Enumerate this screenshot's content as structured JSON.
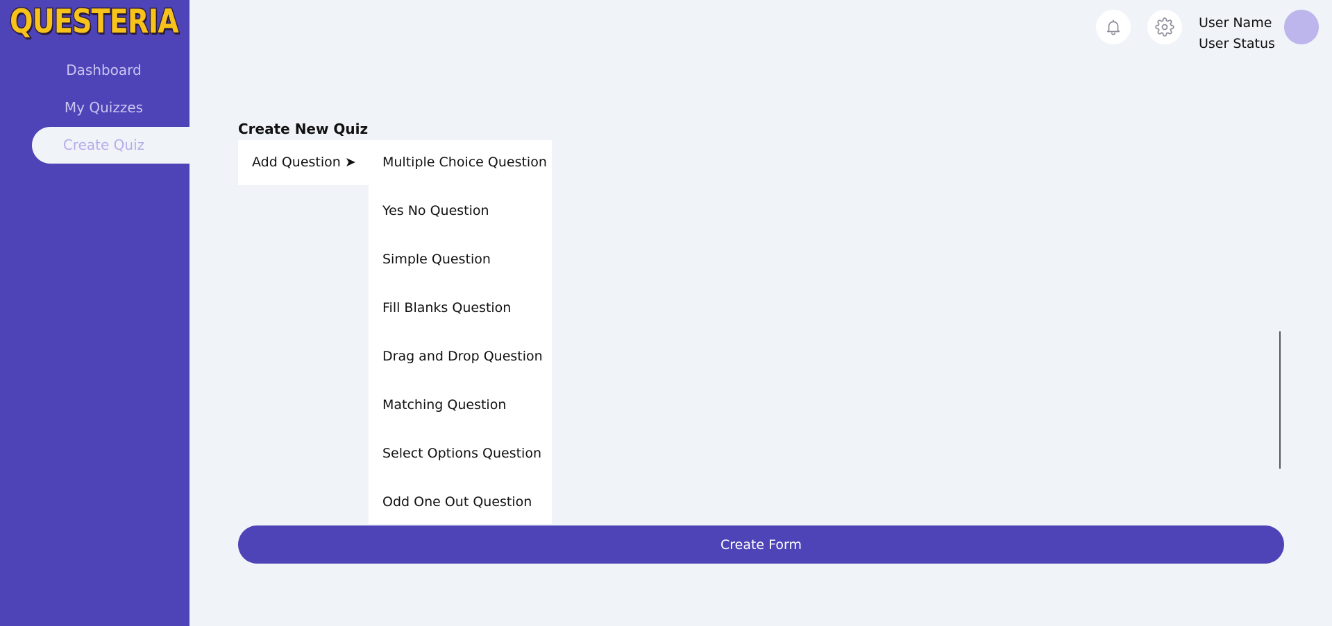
{
  "app": {
    "logo_text": "QUESTERIA"
  },
  "sidebar": {
    "items": [
      {
        "label": "Dashboard"
      },
      {
        "label": "My Quizzes"
      },
      {
        "label": "Create Quiz"
      }
    ]
  },
  "header": {
    "user_name": "User Name",
    "user_status": "User Status",
    "icons": [
      "bell-icon",
      "gear-icon"
    ]
  },
  "main": {
    "title": "Create New Quiz",
    "add_question_label": "Add Question ➤",
    "question_types": [
      "Multiple Choice Question",
      "Yes No Question",
      "Simple Question",
      "Fill Blanks Question",
      "Drag and Drop Question",
      "Matching Question",
      "Select Options Question",
      "Odd One Out Question"
    ],
    "create_form_label": "Create Form"
  },
  "colors": {
    "sidebar_bg": "#4e44b7",
    "page_bg": "#f0f3f8",
    "logo_yellow": "#f7c21a",
    "avatar": "#bcb6ec"
  }
}
